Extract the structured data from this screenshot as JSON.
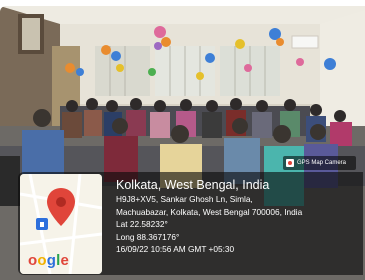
{
  "badge": {
    "icon": "gps-map-camera-icon",
    "label": "GPS Map Camera"
  },
  "location": {
    "title": "Kolkata, West Bengal, India",
    "address_line1": "H9J8+XV5, Sankar Ghosh Ln, Simla,",
    "address_line2": "Machuabazar, Kolkata, West Bengal 700006, India",
    "lat": "Lat 22.58232°",
    "long": "Long 88.367176°",
    "datetime": "16/09/22 10:56 AM GMT +05:30"
  },
  "map": {
    "pin_icon": "map-pin-icon",
    "watermark": "Google",
    "watermark_visible": "oogle",
    "colors": {
      "pin": "#e0453a",
      "map_bg": "#f6f3e9",
      "road": "#ffffff",
      "lock_blue": "#2d6fdc"
    }
  },
  "colors": {
    "wall": "#e9e6dc",
    "overlay": "rgba(10,10,10,0.62)"
  }
}
